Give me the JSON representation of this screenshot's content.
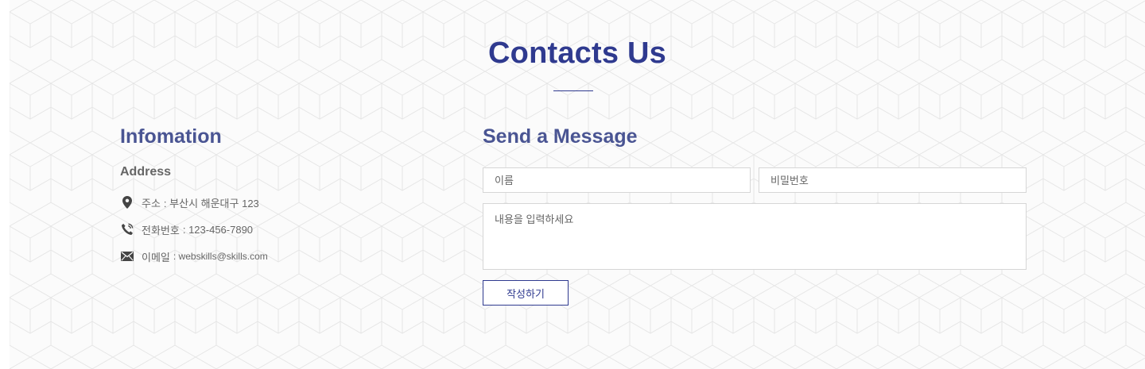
{
  "section": {
    "title": "Contacts Us"
  },
  "info": {
    "heading": "Infomation",
    "address_heading": "Address",
    "items": [
      {
        "icon": "location-pin-icon",
        "label": "주소",
        "value": ": 부산시 해운대구 123"
      },
      {
        "icon": "phone-icon",
        "label": "전화번호",
        "value": ": 123-456-7890"
      },
      {
        "icon": "envelope-icon",
        "label": "이메일",
        "value": ": webskills@skills.com"
      }
    ]
  },
  "form": {
    "heading": "Send a Message",
    "name_placeholder": "이름",
    "password_placeholder": "비밀번호",
    "message_placeholder": "내용을 입력하세요",
    "submit_label": "작성하기"
  },
  "colors": {
    "accent": "#2f3a8f",
    "heading": "#4a5593",
    "text": "#666666",
    "border": "#d6d6d6",
    "background": "#fbfbfb"
  }
}
